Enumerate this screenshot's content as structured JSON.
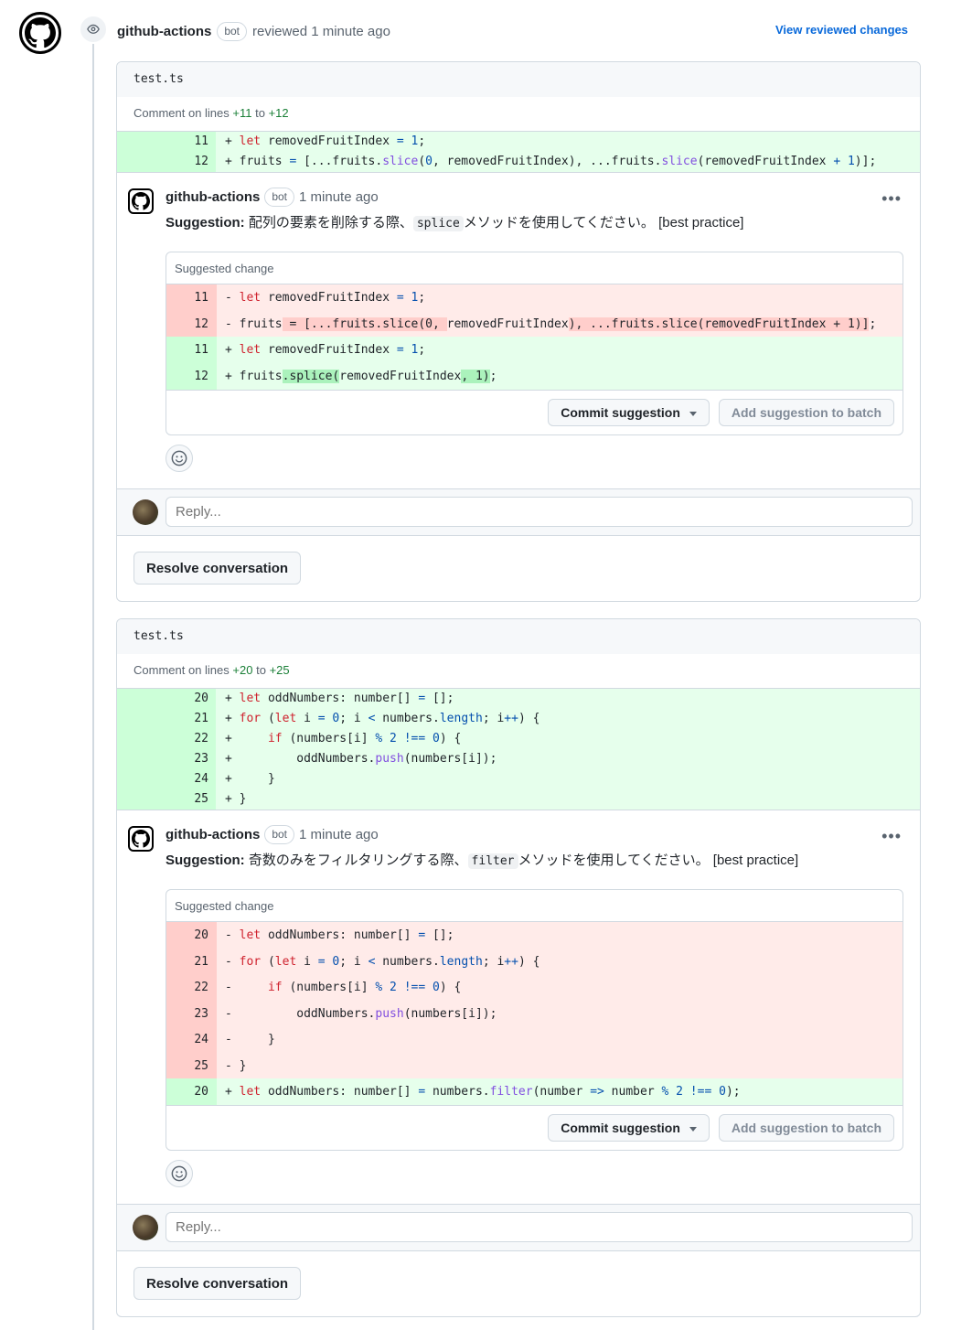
{
  "review": {
    "author": "github-actions",
    "badge": "bot",
    "action": "reviewed 1 minute ago",
    "view_link": "View reviewed changes"
  },
  "threads": [
    {
      "file": "test.ts",
      "lines_prefix": "Comment on lines",
      "lines_from": "+11",
      "lines_to_word": "to",
      "lines_to": "+12",
      "comment": {
        "author": "github-actions",
        "badge": "bot",
        "time": "1 minute ago",
        "suggestion_label": "Suggestion:",
        "text_before": "配列の要素を削除する際、",
        "code": "splice",
        "text_after": "メソッドを使用してください。 [best practice]"
      },
      "suggested_change_label": "Suggested change",
      "commit_label": "Commit suggestion",
      "batch_label": "Add suggestion to batch",
      "reply_placeholder": "Reply...",
      "resolve_label": "Resolve conversation"
    },
    {
      "file": "test.ts",
      "lines_prefix": "Comment on lines",
      "lines_from": "+20",
      "lines_to_word": "to",
      "lines_to": "+25",
      "comment": {
        "author": "github-actions",
        "badge": "bot",
        "time": "1 minute ago",
        "suggestion_label": "Suggestion:",
        "text_before": "奇数のみをフィルタリングする際、",
        "code": "filter",
        "text_after": "メソッドを使用してください。 [best practice]"
      },
      "suggested_change_label": "Suggested change",
      "commit_label": "Commit suggestion",
      "batch_label": "Add suggestion to batch",
      "reply_placeholder": "Reply...",
      "resolve_label": "Resolve conversation"
    }
  ],
  "diff_lines": {
    "t1": [
      {
        "n": "11",
        "code": "+ let removedFruitIndex = 1;"
      },
      {
        "n": "12",
        "code": "+ fruits = [...fruits.slice(0, removedFruitIndex), ...fruits.slice(removedFruitIndex + 1)];"
      }
    ],
    "t2": [
      {
        "n": "20",
        "code": "+ let oddNumbers: number[] = [];"
      },
      {
        "n": "21",
        "code": "+ for (let i = 0; i < numbers.length; i++) {"
      },
      {
        "n": "22",
        "code": "+     if (numbers[i] % 2 !== 0) {"
      },
      {
        "n": "23",
        "code": "+         oddNumbers.push(numbers[i]);"
      },
      {
        "n": "24",
        "code": "+     }"
      },
      {
        "n": "25",
        "code": "+ }"
      }
    ]
  },
  "suggestions": {
    "t1": {
      "del": [
        {
          "n": "11",
          "code": "- let removedFruitIndex = 1;"
        },
        {
          "n": "12",
          "code": "- fruits = [...fruits.slice(0, removedFruitIndex), ...fruits.slice(removedFruitIndex + 1)];"
        }
      ],
      "ins": [
        {
          "n": "11",
          "code": "+ let removedFruitIndex = 1;"
        },
        {
          "n": "12",
          "code": "+ fruits.splice(removedFruitIndex, 1);"
        }
      ]
    },
    "t2": {
      "del": [
        {
          "n": "20",
          "code": "- let oddNumbers: number[] = [];"
        },
        {
          "n": "21",
          "code": "- for (let i = 0; i < numbers.length; i++) {"
        },
        {
          "n": "22",
          "code": "-     if (numbers[i] % 2 !== 0) {"
        },
        {
          "n": "23",
          "code": "-         oddNumbers.push(numbers[i]);"
        },
        {
          "n": "24",
          "code": "-     }"
        },
        {
          "n": "25",
          "code": "- }"
        }
      ],
      "ins": [
        {
          "n": "20",
          "code": "+ let oddNumbers: number[] = numbers.filter(number => number % 2 !== 0);"
        }
      ]
    }
  },
  "icons": {
    "github_logo": "github-mark-icon",
    "eye": "eye-icon",
    "kebab": "kebab-horizontal-icon",
    "emoji": "smiley-icon",
    "caret": "triangle-down-icon"
  },
  "colors": {
    "add_bg": "#e6ffec",
    "add_num_bg": "#ccffd8",
    "del_bg": "#ffebe9",
    "del_num_bg": "#ffcecb",
    "link": "#0969da",
    "add_text": "#1a7f37"
  }
}
